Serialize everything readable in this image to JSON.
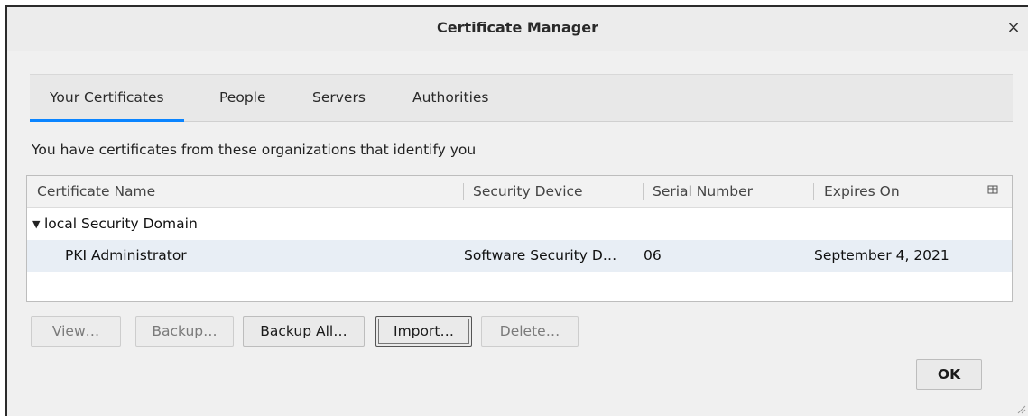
{
  "window": {
    "title": "Certificate Manager",
    "close_glyph": "×"
  },
  "tabs": [
    {
      "label": "Your Certificates",
      "active": true
    },
    {
      "label": "People",
      "active": false
    },
    {
      "label": "Servers",
      "active": false
    },
    {
      "label": "Authorities",
      "active": false
    }
  ],
  "intro_text": "You have certificates from these organizations that identify you",
  "table": {
    "columns": [
      "Certificate Name",
      "Security Device",
      "Serial Number",
      "Expires On"
    ],
    "column_picker_icon": "column-picker-icon",
    "groups": [
      {
        "name": "local Security Domain",
        "expanded": true,
        "rows": [
          {
            "name": "PKI Administrator",
            "device": "Software Security D…",
            "serial": "06",
            "expires": "September 4, 2021",
            "selected": true
          }
        ]
      }
    ]
  },
  "buttons": {
    "view": "View…",
    "backup": "Backup…",
    "backup_all": "Backup All…",
    "import": "Import…",
    "delete": "Delete…",
    "ok": "OK"
  },
  "colors": {
    "accent": "#0a84ff",
    "selected_row": "#e8eef5"
  }
}
